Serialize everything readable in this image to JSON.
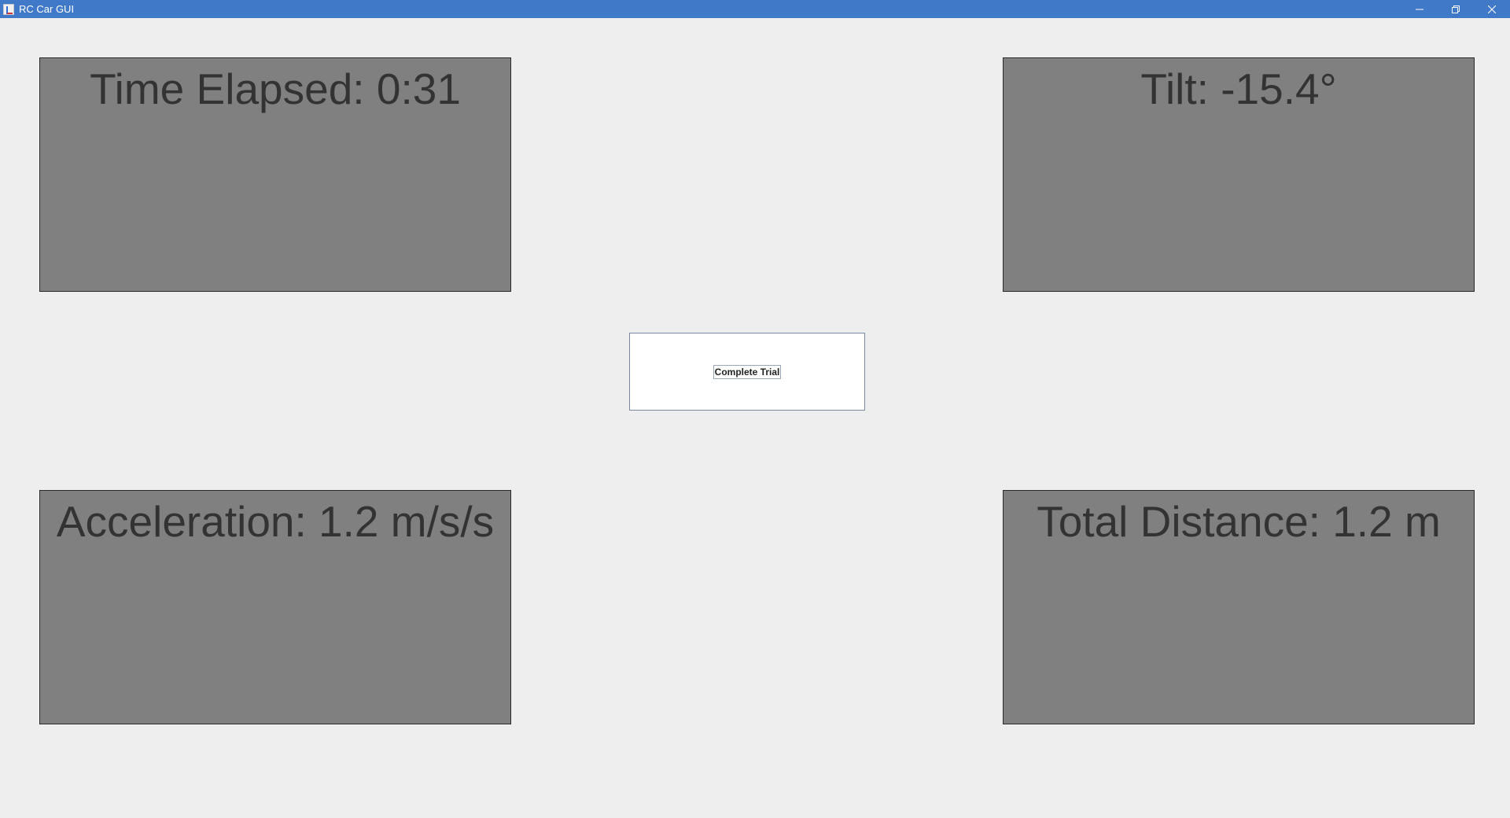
{
  "window": {
    "title": "RC Car GUI",
    "icon": "java-app-icon",
    "controls": [
      "minimize-icon",
      "restore-icon",
      "close-icon"
    ]
  },
  "colors": {
    "titlebar": "#4179c9",
    "background": "#eeeeee",
    "panel": "#808080",
    "panel_text": "#333333"
  },
  "panels": {
    "time_elapsed": "Time Elapsed: 0:31",
    "tilt": "Tilt: -15.4°",
    "acceleration": "Acceleration: 1.2 m/s/s",
    "total_distance": "Total Distance: 1.2 m"
  },
  "actions": {
    "complete_trial_label": "Complete Trial"
  }
}
